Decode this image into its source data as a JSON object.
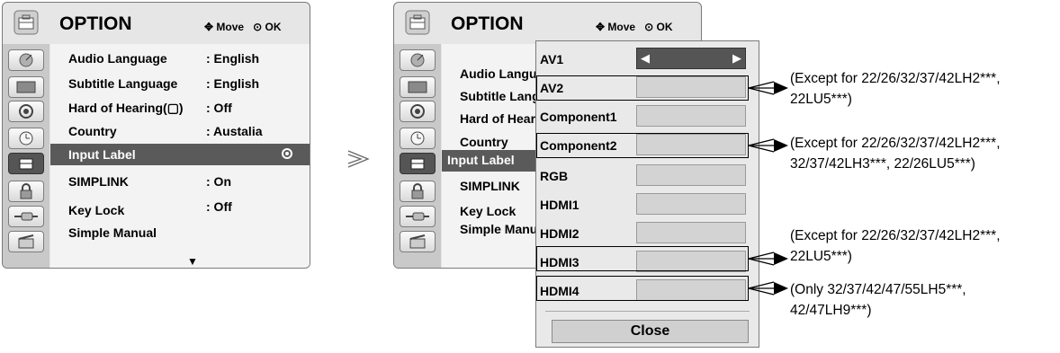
{
  "left_menu": {
    "title": "OPTION",
    "hint_move": "Move",
    "hint_ok": "OK",
    "items": [
      {
        "label": "Audio Language",
        "value": ": English"
      },
      {
        "label": "Subtitle Language",
        "value": ": English"
      },
      {
        "label": "Hard of Hearing(",
        "glyph": "▢",
        "label_end": ")",
        "value": ": Off"
      },
      {
        "label": "Country",
        "value": ":  Austalia"
      },
      {
        "label": "Input Label",
        "value": ""
      },
      {
        "label": "SIMPLINK",
        "value": ": On"
      },
      {
        "label": "Key Lock",
        "value": ": Off"
      },
      {
        "label": "Simple Manual",
        "value": ""
      }
    ],
    "selected_item": "Input Label",
    "more_indicator": "▼"
  },
  "separator_arrow": ">",
  "right_menu": {
    "title": "OPTION",
    "hint_move": "Move",
    "hint_ok": "OK",
    "items": [
      {
        "label": "Audio Langua"
      },
      {
        "label": "Subtitle Lang"
      },
      {
        "label": "Hard of Hearin"
      },
      {
        "label": "Country"
      },
      {
        "label": "Input Label"
      },
      {
        "label": "SIMPLINK"
      },
      {
        "label": "Key Lock"
      },
      {
        "label": "Simple Manua"
      }
    ]
  },
  "popup": {
    "rows": [
      {
        "label": "AV1",
        "active": true,
        "left_arrow": "◀",
        "right_arrow": "▶"
      },
      {
        "label": "AV2"
      },
      {
        "label": "Component1"
      },
      {
        "label": "Component2"
      },
      {
        "label": "RGB"
      },
      {
        "label": "HDMI1"
      },
      {
        "label": "HDMI2"
      },
      {
        "label": "HDMI3"
      },
      {
        "label": "HDMI4"
      }
    ],
    "close_label": "Close"
  },
  "notes": [
    {
      "line1": "(Except for 22/26/32/37/42LH2***,",
      "line2": "22LU5***)"
    },
    {
      "line1": "(Except for 22/26/32/37/42LH2***,",
      "line2": "32/37/42LH3***, 22/26LU5***)"
    },
    {
      "line1": "(Except for 22/26/32/37/42LH2***,",
      "line2": "22LU5***)"
    },
    {
      "line1": "(Only 32/37/42/47/55LH5***,",
      "line2": "42/47LH9***)"
    }
  ],
  "colors": {
    "menu_bg": "#e6e6e6",
    "selected_bg": "#5a5a5a",
    "field_bg": "#d3d3d3"
  }
}
